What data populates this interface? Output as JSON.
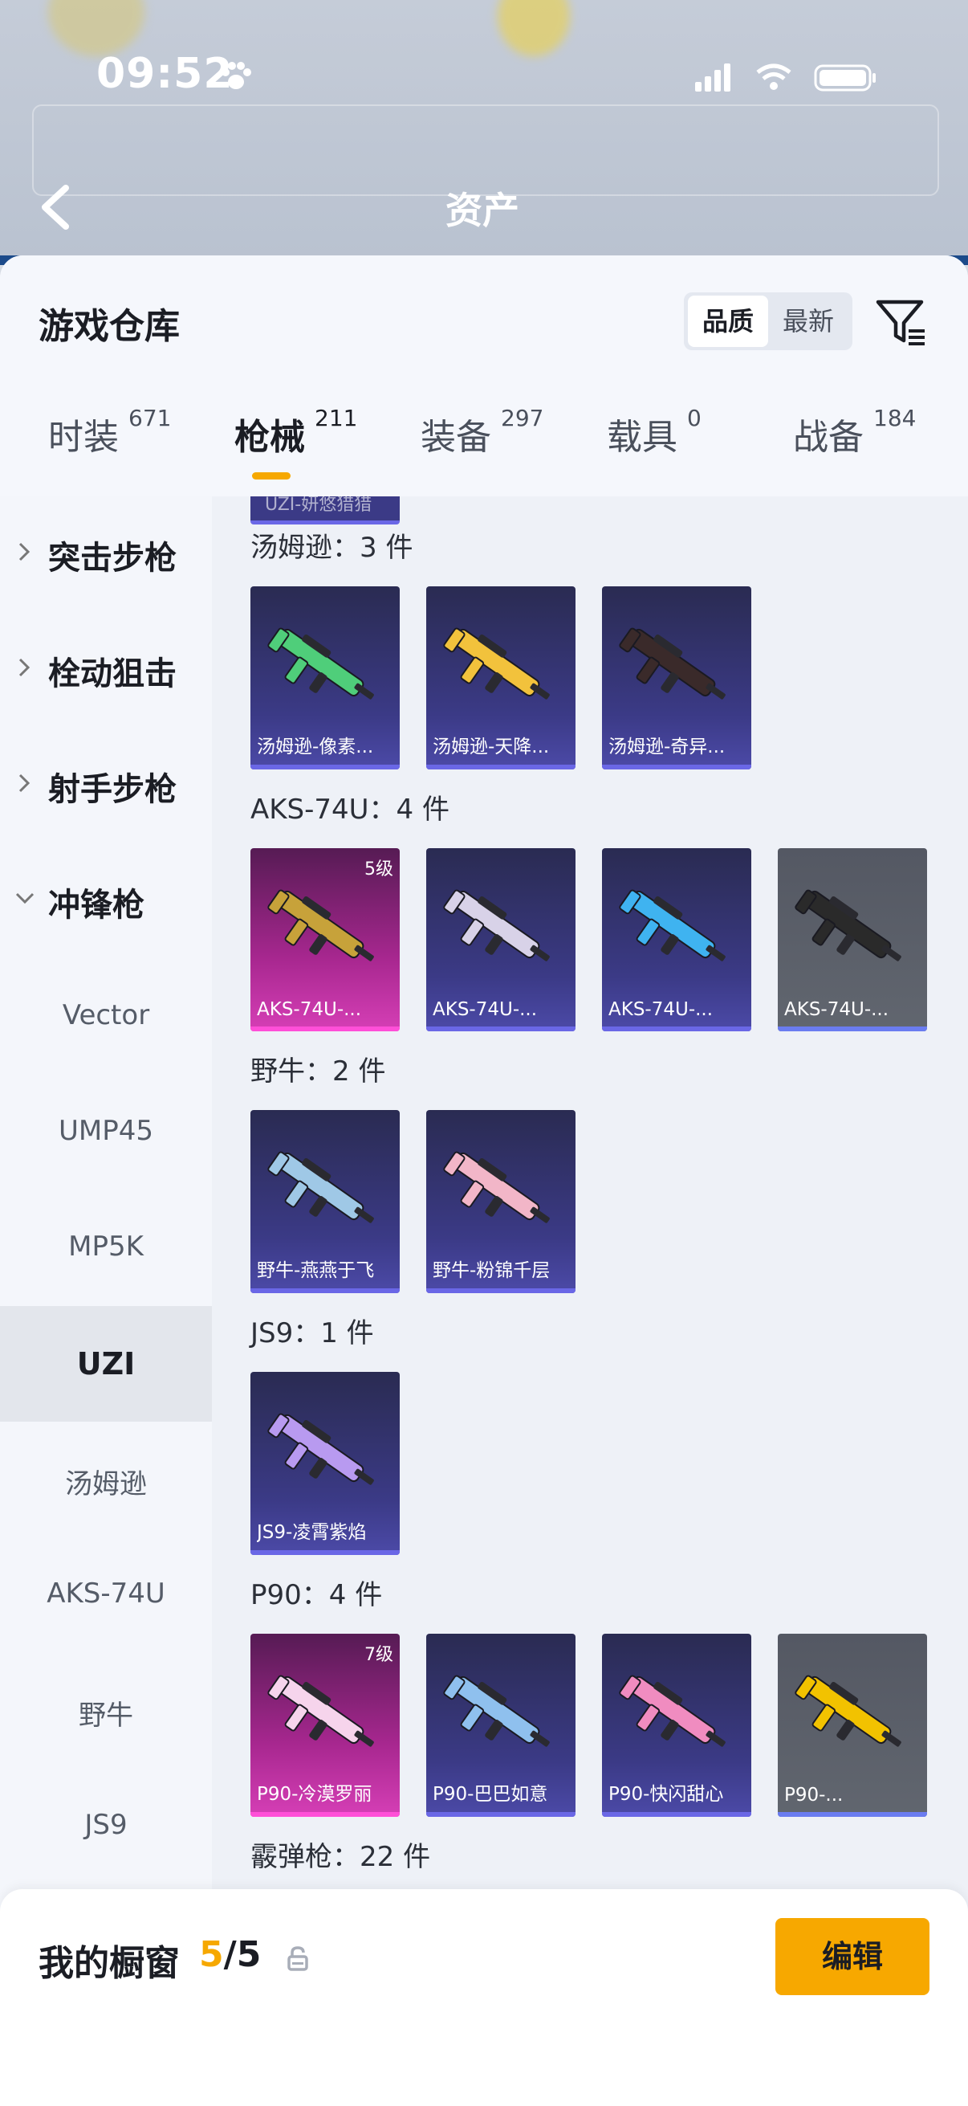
{
  "status_bar": {
    "time": "09:52"
  },
  "header": {
    "title": "资产"
  },
  "warehouse": {
    "title": "游戏仓库",
    "sort_options": [
      "品质",
      "最新"
    ]
  },
  "tabs": [
    {
      "label": "时装",
      "count": "671"
    },
    {
      "label": "枪械",
      "count": "211"
    },
    {
      "label": "装备",
      "count": "297"
    },
    {
      "label": "载具",
      "count": "0"
    },
    {
      "label": "战备",
      "count": "184"
    }
  ],
  "sidebar": {
    "groups": [
      {
        "label": "突击步枪",
        "expanded": false
      },
      {
        "label": "栓动狙击",
        "expanded": false
      },
      {
        "label": "射手步枪",
        "expanded": false
      },
      {
        "label": "冲锋枪",
        "expanded": true
      }
    ],
    "subitems": [
      "Vector",
      "UMP45",
      "MP5K",
      "UZI",
      "汤姆逊",
      "AKS-74U",
      "野牛",
      "JS9"
    ],
    "selected": "UZI"
  },
  "partial_top_card": "UZI-妍悠猎猎",
  "sections": [
    {
      "title": "汤姆逊：3 件",
      "items": [
        {
          "name": "汤姆逊-像素...",
          "level": "",
          "rarity": "purple",
          "gun_color": "#4fce7a"
        },
        {
          "name": "汤姆逊-天降...",
          "level": "",
          "rarity": "purple",
          "gun_color": "#f2c23c"
        },
        {
          "name": "汤姆逊-奇异...",
          "level": "",
          "rarity": "purple",
          "gun_color": "#3a2a2a"
        }
      ]
    },
    {
      "title": "AKS-74U：4 件",
      "items": [
        {
          "name": "AKS-74U-...",
          "level": "5级",
          "rarity": "pink",
          "gun_color": "#c7a23a"
        },
        {
          "name": "AKS-74U-...",
          "level": "",
          "rarity": "purple",
          "gun_color": "#d8d2e8"
        },
        {
          "name": "AKS-74U-...",
          "level": "",
          "rarity": "purple",
          "gun_color": "#3fb3f0"
        },
        {
          "name": "AKS-74U-...",
          "level": "",
          "rarity": "gray",
          "gun_color": "#2a2a2a"
        }
      ]
    },
    {
      "title": "野牛：2 件",
      "items": [
        {
          "name": "野牛-燕燕于飞",
          "level": "",
          "rarity": "purple",
          "gun_color": "#9fc8e6"
        },
        {
          "name": "野牛-粉锦千层",
          "level": "",
          "rarity": "purple",
          "gun_color": "#f2b6c8"
        }
      ]
    },
    {
      "title": "JS9：1 件",
      "items": [
        {
          "name": "JS9-凌霄紫焰",
          "level": "",
          "rarity": "purple",
          "gun_color": "#b89af0"
        }
      ]
    },
    {
      "title": "P90：4 件",
      "items": [
        {
          "name": "P90-冷漠罗丽",
          "level": "7级",
          "rarity": "pink",
          "gun_color": "#f6d4ec"
        },
        {
          "name": "P90-巴巴如意",
          "level": "",
          "rarity": "purple",
          "gun_color": "#8fc0ee"
        },
        {
          "name": "P90-快闪甜心",
          "level": "",
          "rarity": "purple",
          "gun_color": "#f08cc0"
        },
        {
          "name": "P90-...",
          "level": "",
          "rarity": "gray",
          "gun_color": "#f2c200"
        }
      ]
    },
    {
      "title": "霰弹枪：22 件",
      "items": []
    }
  ],
  "showcase": {
    "title": "我的橱窗",
    "current": "5",
    "separator": "/",
    "total": "5",
    "edit_label": "编辑"
  },
  "colors": {
    "accent": "#f6a800",
    "rarity_purple": "#3b3a86",
    "rarity_pink": "#a7278f",
    "rarity_gray": "#61666f"
  }
}
